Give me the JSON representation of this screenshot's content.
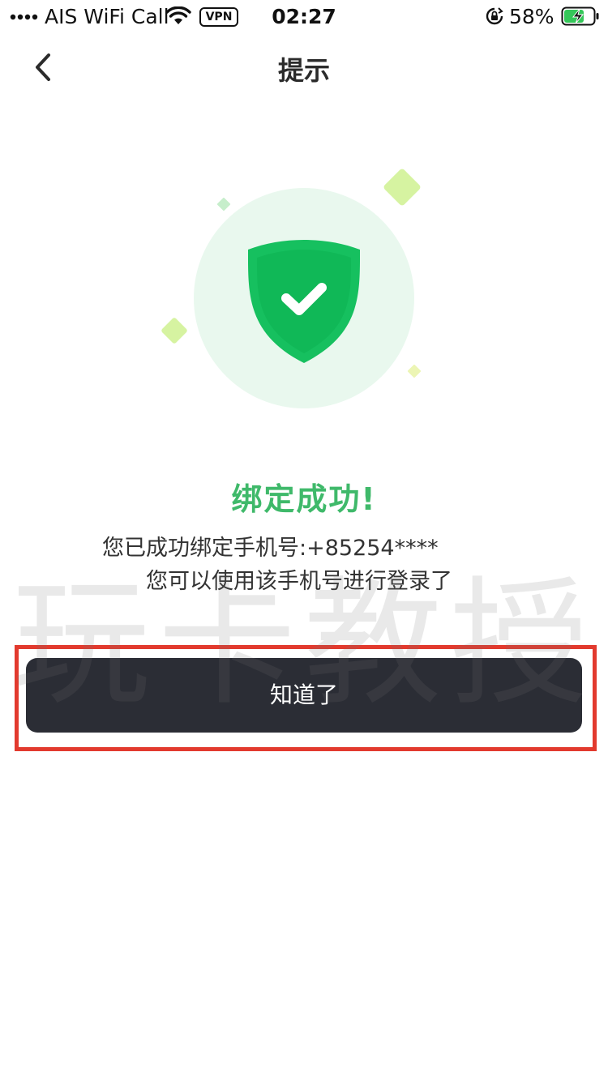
{
  "status_bar": {
    "carrier": "AIS WiFi Call",
    "vpn": "VPN",
    "time": "02:27",
    "battery_percent": "58%"
  },
  "nav": {
    "title": "提示",
    "back_icon": "chevron-left-icon"
  },
  "illustration": {
    "icon": "shield-check-icon",
    "accent_color": "#14c464",
    "circle_color": "#e9f8ee"
  },
  "result": {
    "title": "绑定成功!",
    "line1": "您已成功绑定手机号:+85254****",
    "line2": "您可以使用该手机号进行登录了"
  },
  "actions": {
    "confirm_label": "知道了"
  },
  "watermark": {
    "text": "玩卡教授"
  },
  "colors": {
    "success_text": "#3fb96a",
    "button_bg": "#2b2d35",
    "highlight": "#e23a2e"
  }
}
